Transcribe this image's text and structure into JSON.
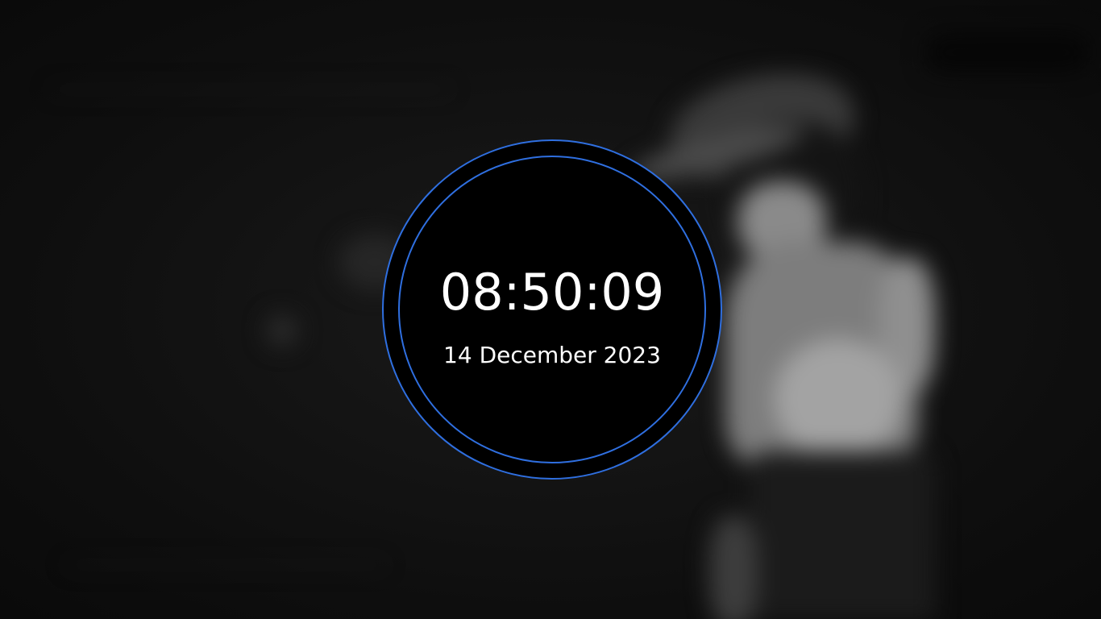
{
  "clock": {
    "time": "08:50:09",
    "date": "14 December 2023"
  },
  "colors": {
    "ring": "#2f6fe0",
    "face": "#000000",
    "text": "#ffffff",
    "background": "#0d0d0d"
  }
}
